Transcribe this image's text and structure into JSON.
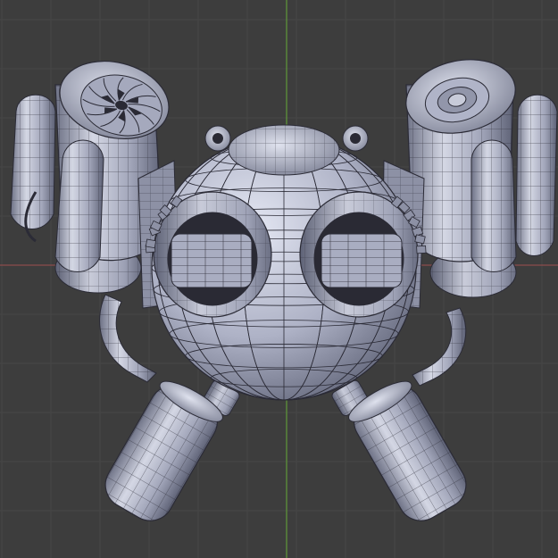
{
  "viewport": {
    "background": "#3d3d3d",
    "grid_color": "#474747",
    "y_axis_color": "#5f9a3a",
    "x_axis_color": "#8b4b4b",
    "mesh_fill_light": "#b9bdd0",
    "mesh_fill_dark": "#676b7f",
    "wire_color": "#2b2b36",
    "dark_recess": "#2a2a34"
  },
  "model": {
    "parts": [
      "robot-head-sphere",
      "goggle-left",
      "goggle-right",
      "jetpack-left",
      "jetpack-right",
      "canister-left",
      "canister-right",
      "arm-tube-left",
      "arm-tube-right",
      "top-bolt-left",
      "top-bolt-right"
    ]
  }
}
